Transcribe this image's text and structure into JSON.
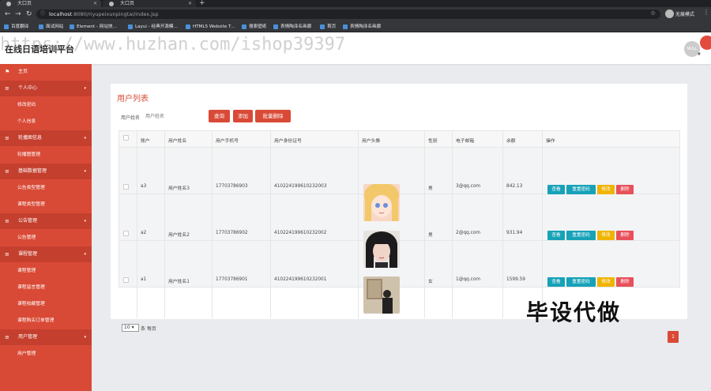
{
  "browser": {
    "tabs": [
      {
        "label": "大口页"
      },
      {
        "label": "大口页"
      }
    ],
    "url_host": "localhost",
    "url_path": ":8080/riyupeixunpingtai/index.jsp",
    "profile_label": "无痕模式",
    "bookmarks": [
      "百度翻译",
      "面试网站",
      "Element - 网站快...",
      "Layui - 经典开源模...",
      "HTML5 Website T...",
      "搜索壁纸",
      "表情陶泽名画廊",
      "首页",
      "表情陶泽名画廊"
    ]
  },
  "app": {
    "brand": "在线日语培训平台",
    "avatar_label": "NULL"
  },
  "sidebar": {
    "items": [
      {
        "label": "主页",
        "type": "group",
        "icon": "flag-icon"
      },
      {
        "label": "个人中心",
        "type": "group",
        "icon": "menu-icon"
      },
      {
        "label": "修改密码",
        "type": "sub"
      },
      {
        "label": "个人信息",
        "type": "sub"
      },
      {
        "label": "轮播图信息",
        "type": "group",
        "icon": "menu-icon"
      },
      {
        "label": "轮播图管理",
        "type": "sub"
      },
      {
        "label": "基础数据管理",
        "type": "group",
        "icon": "menu-icon"
      },
      {
        "label": "公告类型管理",
        "type": "sub"
      },
      {
        "label": "课程类型管理",
        "type": "sub"
      },
      {
        "label": "公告管理",
        "type": "group",
        "icon": "menu-icon"
      },
      {
        "label": "公告管理",
        "type": "sub"
      },
      {
        "label": "课程管理",
        "type": "group",
        "icon": "menu-icon"
      },
      {
        "label": "课程管理",
        "type": "sub"
      },
      {
        "label": "课程留言管理",
        "type": "sub"
      },
      {
        "label": "课程收藏管理",
        "type": "sub"
      },
      {
        "label": "课程购买订单管理",
        "type": "sub"
      },
      {
        "label": "用户管理",
        "type": "group",
        "icon": "menu-icon"
      },
      {
        "label": "用户管理",
        "type": "sub"
      }
    ]
  },
  "panel": {
    "title": "用户列表",
    "search_label": "用户姓名",
    "search_placeholder": "用户姓名",
    "btn_search": "查询",
    "btn_add": "添加",
    "btn_batch_delete": "批量删除"
  },
  "table": {
    "headers": [
      "账户",
      "用户姓名",
      "用户手机号",
      "用户身份证号",
      "用户头像",
      "性别",
      "电子邮箱",
      "余额",
      "操作"
    ],
    "actions": {
      "view": "查看",
      "reset": "重置密码",
      "edit": "修改",
      "delete": "删除"
    },
    "rows": [
      {
        "account": "a3",
        "name": "用户姓名3",
        "phone": "17703786903",
        "id_card": "410224199610232003",
        "gender": "男",
        "email": "3@qq.com",
        "balance": "842.13"
      },
      {
        "account": "a2",
        "name": "用户姓名2",
        "phone": "17703786902",
        "id_card": "410224199610232002",
        "gender": "男",
        "email": "2@qq.com",
        "balance": "931.94"
      },
      {
        "account": "a1",
        "name": "用户姓名1",
        "phone": "17703786901",
        "id_card": "410224199610232001",
        "gender": "女",
        "email": "1@qq.com",
        "balance": "1599.59"
      }
    ]
  },
  "pagination": {
    "page_size": "10",
    "page_size_label": "条 每页",
    "current_page": "1"
  },
  "overlay": {
    "watermark": "https://www.huzhan.com/ishop39397",
    "stamp": "毕设代做"
  }
}
